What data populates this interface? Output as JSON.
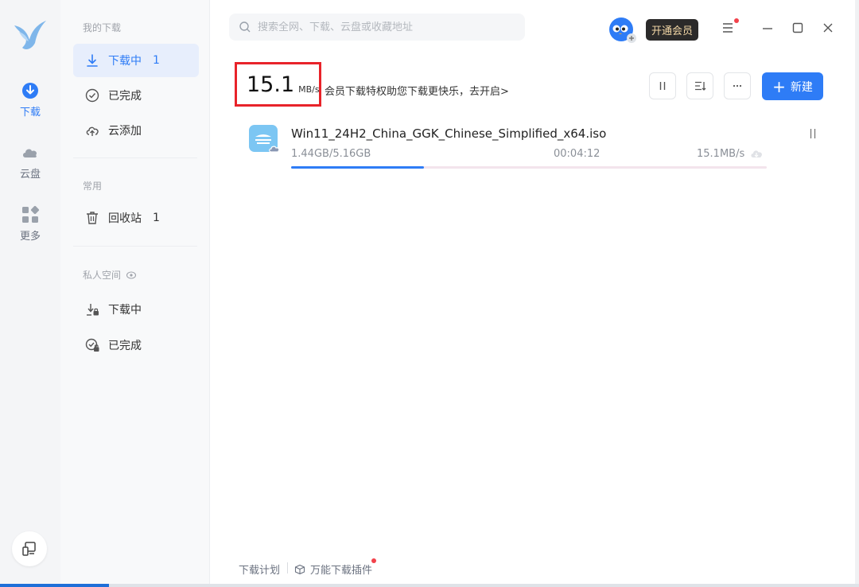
{
  "rail": {
    "items": [
      {
        "label": "下载",
        "icon": "download-circle-icon",
        "active": true
      },
      {
        "label": "云盘",
        "icon": "cloud-icon",
        "active": false
      },
      {
        "label": "更多",
        "icon": "apps-grid-icon",
        "active": false
      }
    ],
    "bottom_icon": "device-transfer-icon"
  },
  "sidebar": {
    "section_mine": "我的下载",
    "items": [
      {
        "label": "下载中",
        "count": "1",
        "icon": "download-arrow-icon"
      },
      {
        "label": "已完成",
        "icon": "check-circle-icon"
      },
      {
        "label": "云添加",
        "icon": "cloud-upload-icon"
      }
    ],
    "section_common": "常用",
    "trash": {
      "label": "回收站",
      "count": "1",
      "icon": "trash-icon"
    },
    "section_private": "私人空间",
    "private_items": [
      {
        "label": "下载中",
        "icon": "lock-download-icon"
      },
      {
        "label": "已完成",
        "icon": "lock-check-icon"
      }
    ]
  },
  "header": {
    "search_placeholder": "搜索全网、下载、云盘或收藏地址",
    "vip_label": "开通会员"
  },
  "summary": {
    "speed_value": "15.1",
    "speed_unit": "MB/s",
    "promo": "会员下载特权助您下载更快乐，去开启>"
  },
  "toolbar": {
    "new_label": "新建",
    "new_plus": "+"
  },
  "downloads": [
    {
      "name": "Win11_24H2_China_GGK_Chinese_Simplified_x64.iso",
      "size": "1.44GB/5.16GB",
      "remaining": "00:04:12",
      "speed": "15.1MB/s",
      "progress": 0.28
    }
  ],
  "footer": {
    "plan": "下载计划",
    "plugin": "万能下载插件"
  },
  "colors": {
    "accent": "#2e7cf6",
    "highlight_border": "#e8232a",
    "notification": "#f2424b",
    "vip_bg": "#2b2a2a",
    "vip_text": "#f3d7a6"
  }
}
